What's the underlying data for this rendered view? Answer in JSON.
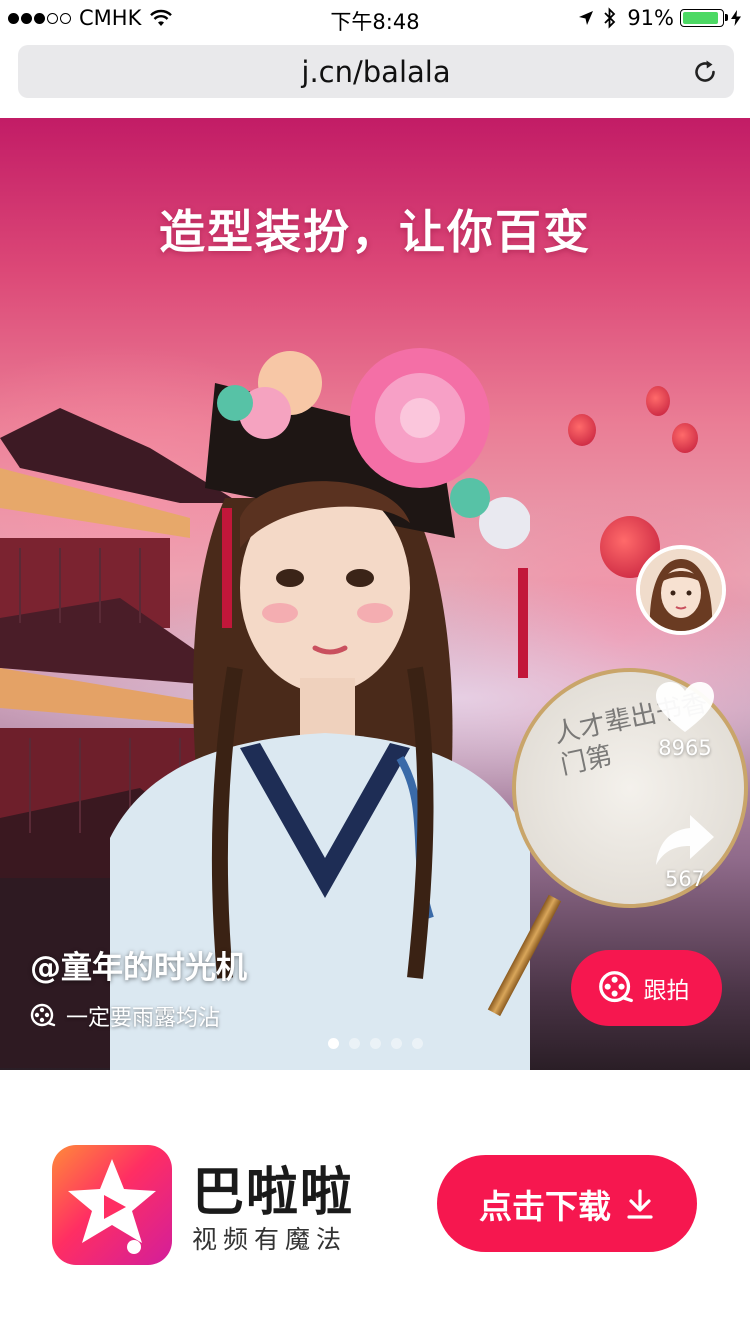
{
  "status_bar": {
    "carrier": "CMHK",
    "time": "下午8:48",
    "battery": "91%",
    "battery_level": 0.91
  },
  "browser": {
    "url": "j.cn/balala"
  },
  "hero": {
    "title": "造型装扮，让你百变",
    "fan_text": "人才辈出书香门第"
  },
  "video": {
    "likes": "8965",
    "shares": "567",
    "author_handle": "@童年的时光机",
    "music_title": "一定要雨露均沾",
    "follow_label": "跟拍",
    "pager": {
      "total": 5,
      "active_index": 0
    }
  },
  "colors": {
    "accent": "#f6174f",
    "battery": "#4cd964"
  },
  "app": {
    "name": "巴啦啦",
    "slogan": "视频有魔法",
    "download_label": "点击下载"
  }
}
